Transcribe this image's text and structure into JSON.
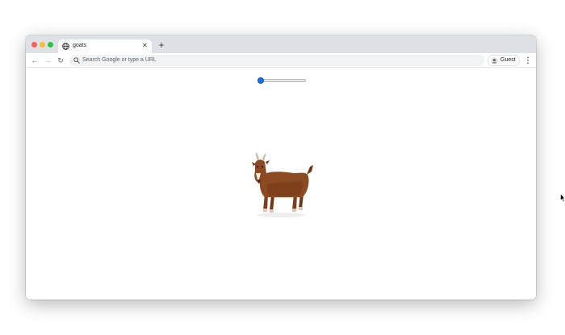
{
  "browser": {
    "tab": {
      "title": "goats",
      "close_glyph": "✕"
    },
    "new_tab_glyph": "+",
    "nav": {
      "back_glyph": "←",
      "forward_glyph": "→",
      "reload_glyph": "↻"
    },
    "omnibox": {
      "placeholder": "Search Google or type a URL"
    },
    "profile": {
      "label": "Guest"
    },
    "traffic_colors": {
      "close": "#ff5f57",
      "minimize": "#febc2e",
      "maximize": "#28c840"
    },
    "accent_color": "#1a73e8"
  },
  "page": {
    "slider": {
      "value": 0,
      "min": 0,
      "max": 1
    },
    "image": {
      "subject": "goat"
    }
  },
  "icons": [
    "globe-icon",
    "close-icon",
    "plus-icon",
    "back-arrow-icon",
    "forward-arrow-icon",
    "reload-icon",
    "search-icon",
    "avatar-icon",
    "kebab-menu-icon",
    "mouse-cursor-icon"
  ]
}
